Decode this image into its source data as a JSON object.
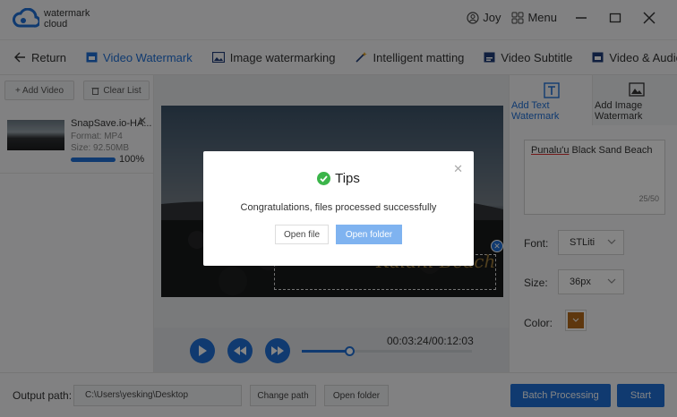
{
  "app": {
    "logo_line1": "watermark",
    "logo_line2": "cloud",
    "user_name": "Joy",
    "menu_label": "Menu"
  },
  "tabs": [
    {
      "label": "Return"
    },
    {
      "label": "Video Watermark",
      "active": true
    },
    {
      "label": "Image watermarking"
    },
    {
      "label": "Intelligent matting"
    },
    {
      "label": "Video Subtitle"
    },
    {
      "label": "Video & Audio Sepa"
    }
  ],
  "left": {
    "add_video": "+ Add Video",
    "clear_list": "Clear List",
    "file": {
      "name": "SnapSave.io-HA...",
      "format": "Format:  MP4",
      "size": "Size:  92.50MB",
      "progress_text": "100%",
      "progress": 1.0
    }
  },
  "player": {
    "watermark_text": "Kalani Beach",
    "time": "00:03:24/00:12:03",
    "seek_fraction": 0.28
  },
  "right": {
    "tab_text": "Add Text Watermark",
    "tab_image": "Add Image Watermark",
    "text_value_underlined": "Punalu'u",
    "text_value_rest": " Black Sand Beach",
    "counter": "25/50",
    "font_label": "Font:",
    "font_value": "STLiti",
    "size_label": "Size:",
    "size_value": "36px",
    "color_label": "Color:",
    "color_value": "#b46a1c"
  },
  "bottom": {
    "output_label": "Output path:",
    "output_path": "C:\\Users\\yesking\\Desktop",
    "change_path": "Change path",
    "open_folder": "Open folder",
    "batch_processing": "Batch Processing",
    "start": "Start"
  },
  "dialog": {
    "title": "Tips",
    "message": "Congratulations, files processed successfully",
    "open_file": "Open file",
    "open_folder": "Open folder"
  },
  "colors": {
    "accent": "#1f6fd6",
    "success": "#3bb54a",
    "overlay": "rgba(0,0,0,0.48)"
  }
}
